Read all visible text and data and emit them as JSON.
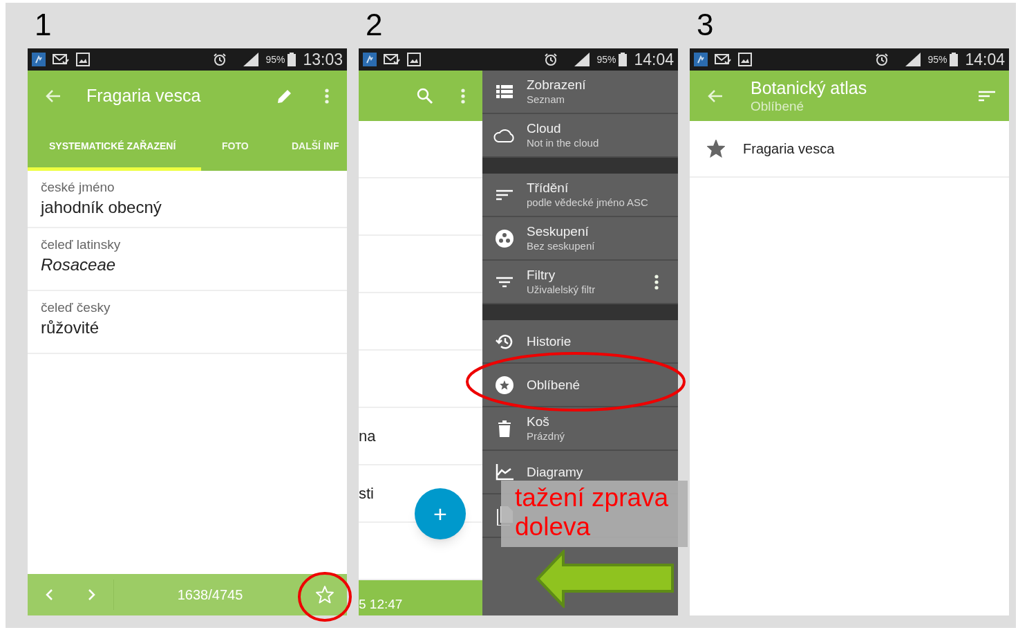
{
  "screens": [
    {
      "kind": "detail",
      "step": "1",
      "status_bar": {
        "battery": "95%",
        "time": "13:03"
      },
      "toolbar": {
        "title": "Fragaria vesca"
      },
      "tabs": [
        {
          "label": "SYSTEMATICKÉ ZAŘAZENÍ",
          "selected": true
        },
        {
          "label": "FOTO",
          "selected": false
        },
        {
          "label": "DALŠÍ INF",
          "selected": false
        }
      ],
      "fields": [
        {
          "label": "české jméno",
          "value": "jahodník obecný",
          "italic": false
        },
        {
          "label": "čeleď latinsky",
          "value": "Rosaceae",
          "italic": true
        },
        {
          "label": "čeleď česky",
          "value": "růžovité",
          "italic": false
        }
      ],
      "bottom_bar": {
        "counter": "1638/4745",
        "favorite": false
      }
    },
    {
      "kind": "drawer",
      "step": "2",
      "status_bar": {
        "battery": "95%",
        "time": "14:04"
      },
      "background_rows": [
        {},
        {},
        {},
        {},
        {},
        {
          "text": "na"
        },
        {
          "text": "sti"
        },
        {}
      ],
      "footer_text": "5 12:47",
      "fab_label": "+",
      "drawer": [
        {
          "kind": "item",
          "title": "Zobrazení",
          "subtitle": "Seznam",
          "more": false
        },
        {
          "kind": "item",
          "title": "Cloud",
          "subtitle": "Not in the cloud",
          "more": false
        },
        {
          "kind": "separator"
        },
        {
          "kind": "item",
          "title": "Třídění",
          "subtitle": "podle vědecké jméno ASC",
          "more": false
        },
        {
          "kind": "item",
          "title": "Seskupení",
          "subtitle": "Bez seskupení",
          "more": false
        },
        {
          "kind": "item",
          "title": "Filtry",
          "subtitle": "Uživalelský filtr",
          "more": true
        },
        {
          "kind": "separator"
        },
        {
          "kind": "item",
          "title": "Historie",
          "more": false
        },
        {
          "kind": "item",
          "title": "Oblíbené",
          "more": false
        },
        {
          "kind": "item",
          "title": "Koš",
          "subtitle": "Prázdný",
          "more": false
        },
        {
          "kind": "item",
          "title": "Diagramy",
          "more": false
        },
        {
          "kind": "covered_item"
        }
      ]
    },
    {
      "kind": "favorites",
      "step": "3",
      "status_bar": {
        "battery": "95%",
        "time": "14:04"
      },
      "toolbar": {
        "title": "Botanický atlas",
        "subtitle": "Oblíbené"
      },
      "favorites": [
        {
          "name": "Fragaria vesca",
          "starred": true
        }
      ]
    }
  ],
  "annotation": {
    "note": "tažení zprava doleva"
  }
}
